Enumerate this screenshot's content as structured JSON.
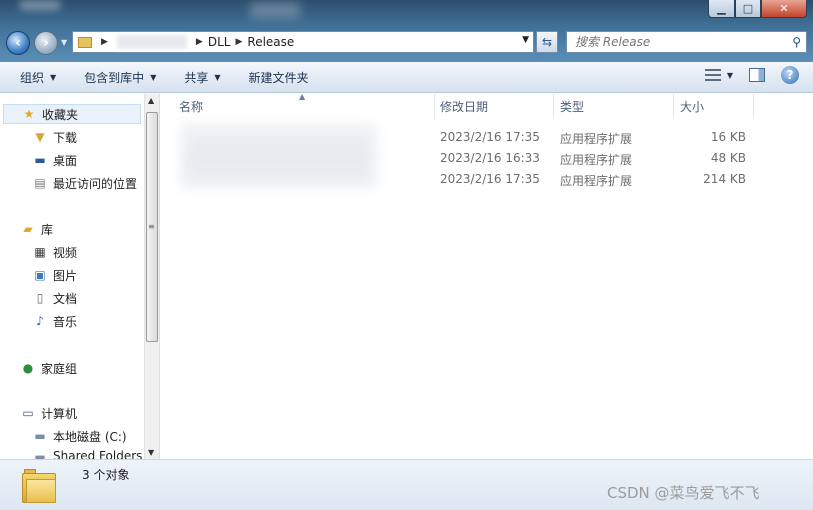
{
  "window": {
    "minimize": "▁",
    "maximize": "□",
    "close": "✕"
  },
  "address": {
    "crumbs": [
      "DLL",
      "Release"
    ]
  },
  "search": {
    "placeholder": "搜索 Release"
  },
  "toolbar": {
    "organize": "组织",
    "include_in_library": "包含到库中",
    "share": "共享",
    "new_folder": "新建文件夹"
  },
  "sidebar": {
    "favorites": "收藏夹",
    "downloads": "下载",
    "desktop": "桌面",
    "recent_places": "最近访问的位置",
    "libraries": "库",
    "videos": "视频",
    "pictures": "图片",
    "documents": "文档",
    "music": "音乐",
    "homegroup": "家庭组",
    "computer": "计算机",
    "local_disk": "本地磁盘 (C:)",
    "shared_folders": "Shared Folders"
  },
  "columns": {
    "name": "名称",
    "modified": "修改日期",
    "type": "类型",
    "size": "大小"
  },
  "files": [
    {
      "modified": "2023/2/16 17:35",
      "type": "应用程序扩展",
      "size": "16 KB"
    },
    {
      "modified": "2023/2/16 16:33",
      "type": "应用程序扩展",
      "size": "48 KB"
    },
    {
      "modified": "2023/2/16 17:35",
      "type": "应用程序扩展",
      "size": "214 KB"
    }
  ],
  "status": {
    "count": "3 个对象"
  },
  "watermark": "CSDN @菜鸟爱飞不飞"
}
